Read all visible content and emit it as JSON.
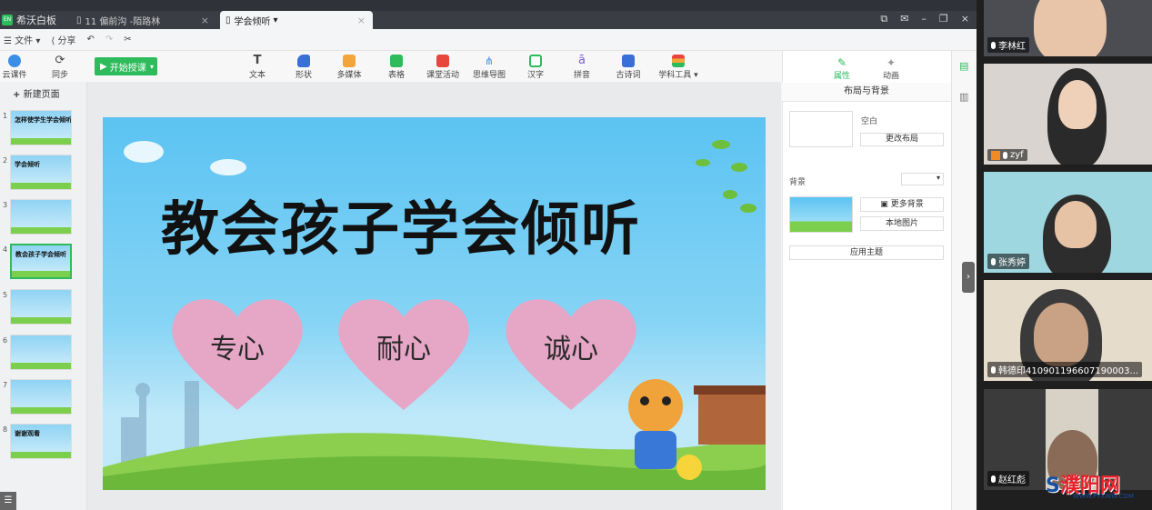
{
  "app": {
    "brand": "希沃白板"
  },
  "tabs": [
    {
      "label": "11 偏前沟 -陌路林"
    },
    {
      "label": "学会倾听"
    }
  ],
  "menu": {
    "file": "文件",
    "share": "分享"
  },
  "toolbar": {
    "cloud": "云课件",
    "sync": "同步",
    "start": "开始授课",
    "items": [
      "文本",
      "形状",
      "多媒体",
      "表格",
      "课堂活动",
      "思维导图",
      "汉字",
      "拼音",
      "古诗词",
      "学科工具"
    ]
  },
  "left": {
    "new_page": "新建页面",
    "thumbs": [
      {
        "num": "1",
        "title": "怎样使学生学会倾听"
      },
      {
        "num": "2",
        "title": "学会倾听"
      },
      {
        "num": "3",
        "title": ""
      },
      {
        "num": "4",
        "title": "教会孩子学会倾听"
      },
      {
        "num": "5",
        "title": ""
      },
      {
        "num": "6",
        "title": ""
      },
      {
        "num": "7",
        "title": ""
      },
      {
        "num": "8",
        "title": "谢谢观看"
      }
    ]
  },
  "slide": {
    "title": "教会孩子学会倾听",
    "hearts": [
      "专心",
      "耐心",
      "诚心"
    ]
  },
  "right": {
    "tab_props": "属性",
    "tab_anim": "动画",
    "header": "布局与背景",
    "blank_label": "空白",
    "change_layout": "更改布局",
    "bg_label": "背景",
    "more_bg": "更多背景",
    "local_pic": "本地图片",
    "apply_theme": "应用主题"
  },
  "participants": [
    "李林红",
    "zyf",
    "张秀婷",
    "韩德印410901196607190003...",
    "赵红彪"
  ],
  "watermark": {
    "text": "濮阳网",
    "url": "WWW.PYXWW.COM"
  },
  "colors": {
    "accent": "#2dbb5b",
    "heart": "#e6a6c6",
    "sky": "#5bc3f2"
  }
}
